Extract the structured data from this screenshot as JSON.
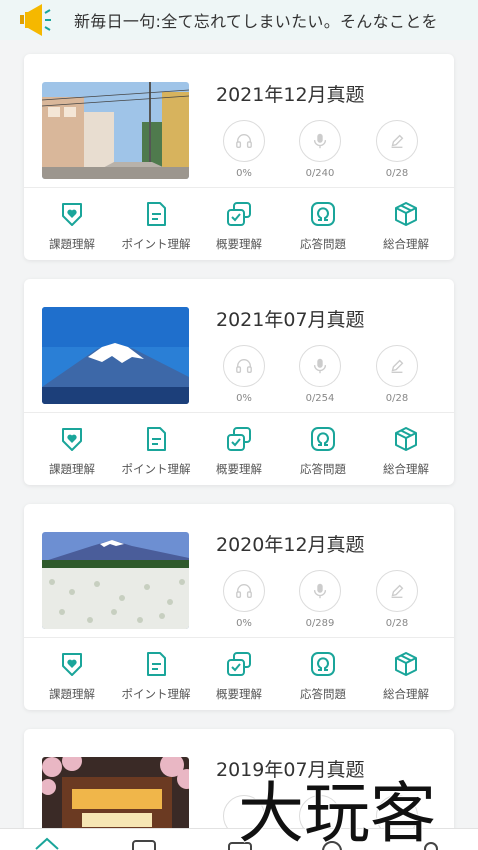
{
  "marquee": {
    "text": "新毎日一句:全て忘れてしまいたい。そんなことを"
  },
  "cards": [
    {
      "title": "2021年12月真题",
      "listen": "0%",
      "voice": "0/240",
      "write": "0/28"
    },
    {
      "title": "2021年07月真题",
      "listen": "0%",
      "voice": "0/254",
      "write": "0/28"
    },
    {
      "title": "2020年12月真题",
      "listen": "0%",
      "voice": "0/289",
      "write": "0/28"
    },
    {
      "title": "2019年07月真题"
    }
  ],
  "categories": [
    "課題理解",
    "ポイント理解",
    "概要理解",
    "応答問題",
    "総合理解"
  ],
  "watermark": {
    "text": "大玩客"
  },
  "colors": {
    "accent": "#1aa59a",
    "marquee_bg": "#eef6f6",
    "horn": "#f5b800"
  }
}
